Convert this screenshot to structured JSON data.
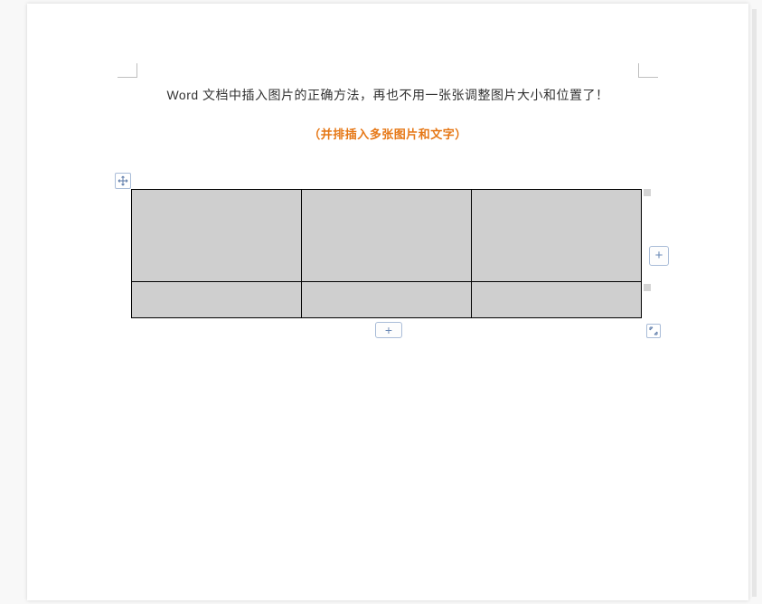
{
  "document": {
    "heading": "Word 文档中插入图片的正确方法，再也不用一张张调整图片大小和位置了！",
    "subheading": "（并排插入多张图片和文字）"
  },
  "table": {
    "rows": 2,
    "cols": 3,
    "cells": [
      [
        "",
        "",
        ""
      ],
      [
        "",
        "",
        ""
      ]
    ]
  },
  "controls": {
    "add_row_label": "+",
    "add_col_label": "+"
  },
  "colors": {
    "accent": "#e67817",
    "handle_border": "#a9bcd8"
  }
}
